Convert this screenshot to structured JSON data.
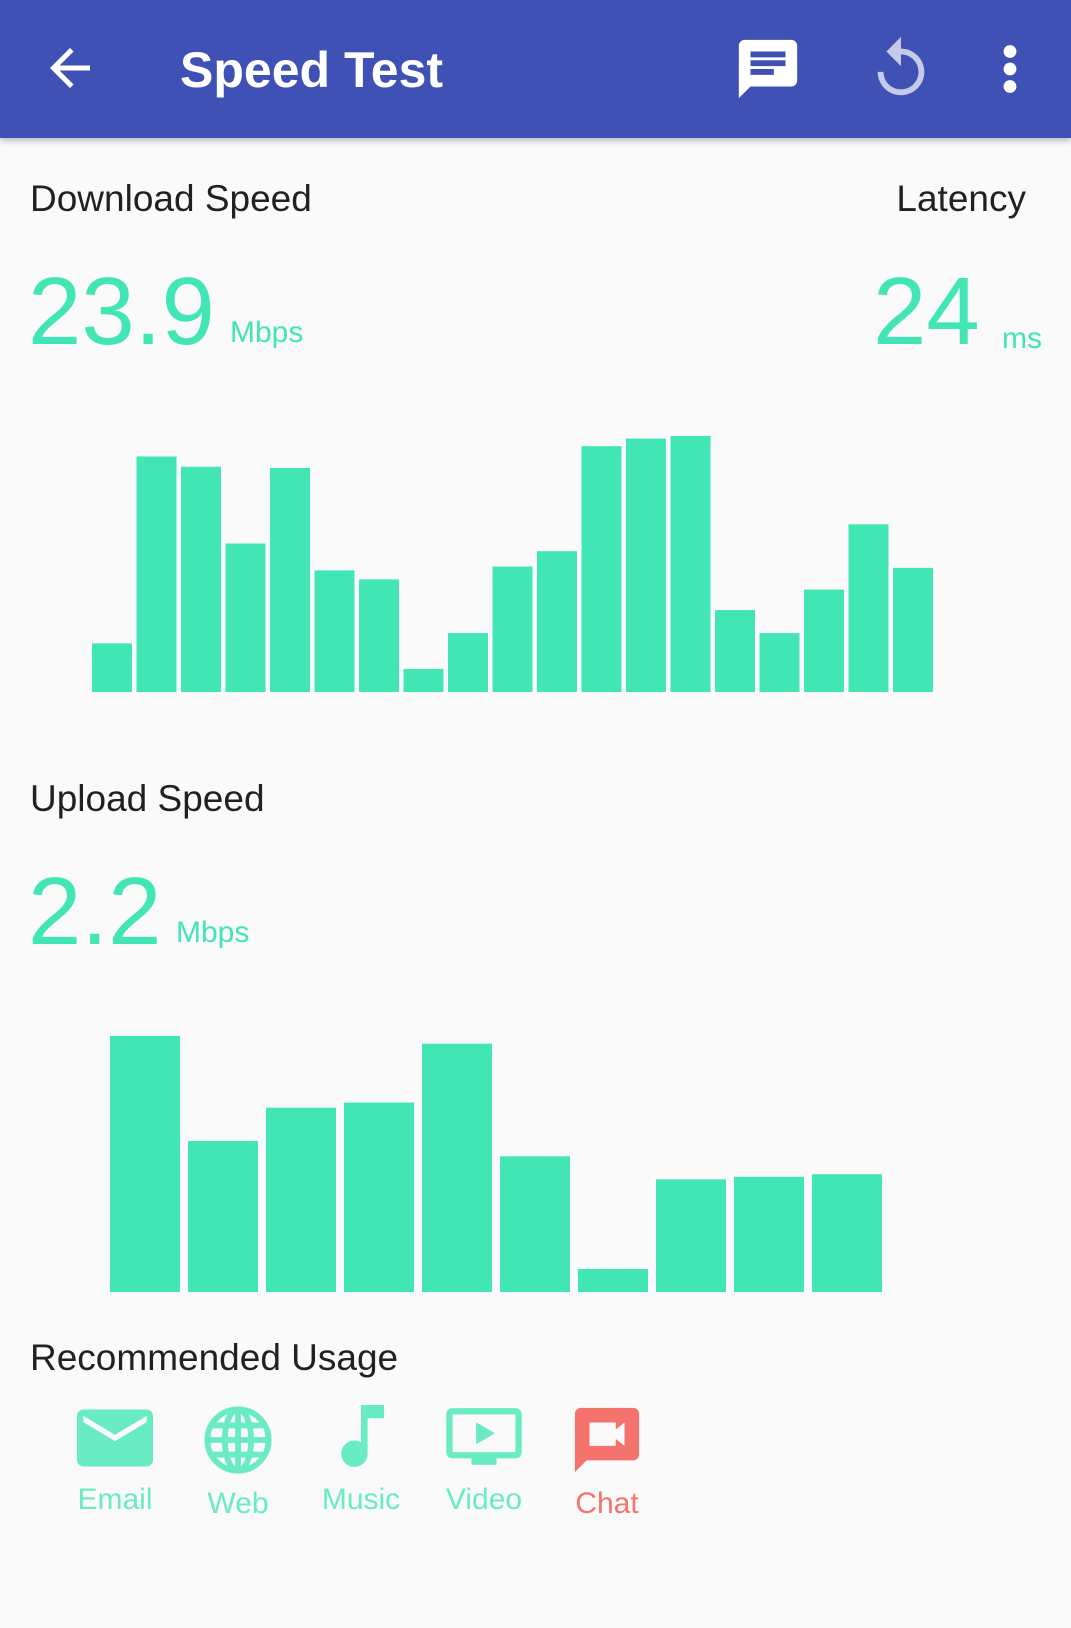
{
  "appbar": {
    "title": "Speed Test",
    "background": "#3f51b5",
    "icons": [
      "arrow-back-icon",
      "chat-icon",
      "refresh-icon",
      "more-vert-icon"
    ]
  },
  "download": {
    "label": "Download Speed",
    "value": "23.9",
    "unit": "Mbps"
  },
  "latency": {
    "label": "Latency",
    "value": "24",
    "unit": "ms"
  },
  "upload": {
    "label": "Upload Speed",
    "value": "2.2",
    "unit": "Mbps"
  },
  "usage": {
    "label": "Recommended Usage",
    "items": [
      {
        "label": "Email",
        "icon": "email-icon",
        "color": "#69ebc4"
      },
      {
        "label": "Web",
        "icon": "globe-icon",
        "color": "#69ebc4"
      },
      {
        "label": "Music",
        "icon": "music-note-icon",
        "color": "#69ebc4"
      },
      {
        "label": "Video",
        "icon": "video-icon",
        "color": "#69ebc4"
      },
      {
        "label": "Chat",
        "icon": "video-chat-icon",
        "color": "#f4736d"
      }
    ]
  },
  "chart_data": [
    {
      "type": "bar",
      "values": [
        0.19,
        0.92,
        0.88,
        0.58,
        0.875,
        0.475,
        0.44,
        0.09,
        0.23,
        0.49,
        0.55,
        0.96,
        0.99,
        1.0,
        0.32,
        0.23,
        0.4,
        0.655,
        0.485
      ],
      "color": "#42e6b5",
      "ylim": [
        0,
        1
      ]
    },
    {
      "type": "bar",
      "values": [
        1.0,
        0.59,
        0.72,
        0.74,
        0.97,
        0.53,
        0.09,
        0.44,
        0.45,
        0.46
      ],
      "color": "#42e6b5",
      "ylim": [
        0,
        1
      ]
    }
  ]
}
